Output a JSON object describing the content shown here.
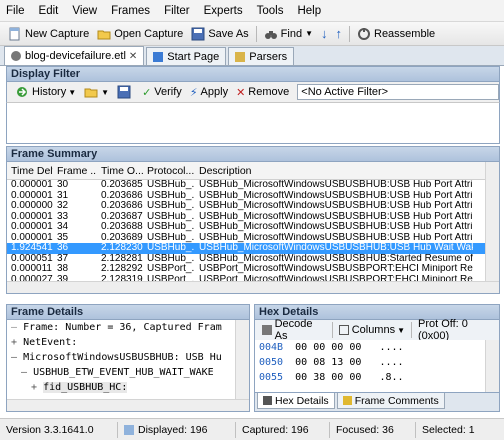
{
  "menu": [
    "File",
    "Edit",
    "View",
    "Frames",
    "Filter",
    "Experts",
    "Tools",
    "Help"
  ],
  "toolbar": {
    "new_capture": "New Capture",
    "open_capture": "Open Capture",
    "save_as": "Save As",
    "find": "Find",
    "reassemble": "Reassemble"
  },
  "tabs": [
    {
      "label": "blog-devicefailure.etl"
    },
    {
      "label": "Start Page"
    },
    {
      "label": "Parsers"
    }
  ],
  "display_filter": {
    "title": "Display Filter",
    "history": "History",
    "verify": "Verify",
    "apply": "Apply",
    "remove": "Remove",
    "active_filter": "<No Active Filter>"
  },
  "frame_summary": {
    "title": "Frame Summary",
    "columns": [
      "Time Delta",
      "Frame ...",
      "Time O...",
      "Protocol...",
      "Description"
    ],
    "rows": [
      {
        "delta": "0.000001",
        "frame": "30",
        "time": "0.203685",
        "protocol": "USBHub_...",
        "desc": "USBHub_MicrosoftWindowsUSBUSBHUB:USB Hub Port Attributes"
      },
      {
        "delta": "0.000001",
        "frame": "31",
        "time": "0.203686",
        "protocol": "USBHub_...",
        "desc": "USBHub_MicrosoftWindowsUSBUSBHUB:USB Hub Port Attributes"
      },
      {
        "delta": "0.000000",
        "frame": "32",
        "time": "0.203686",
        "protocol": "USBHub_...",
        "desc": "USBHub_MicrosoftWindowsUSBUSBHUB:USB Hub Port Attributes"
      },
      {
        "delta": "0.000001",
        "frame": "33",
        "time": "0.203687",
        "protocol": "USBHub_...",
        "desc": "USBHub_MicrosoftWindowsUSBUSBHUB:USB Hub Port Attributes"
      },
      {
        "delta": "0.000001",
        "frame": "34",
        "time": "0.203688",
        "protocol": "USBHub_...",
        "desc": "USBHub_MicrosoftWindowsUSBUSBHUB:USB Hub Port Attributes"
      },
      {
        "delta": "0.000001",
        "frame": "35",
        "time": "0.203689",
        "protocol": "USBHub_...",
        "desc": "USBHub_MicrosoftWindowsUSBUSBHUB:USB Hub Port Attributes"
      },
      {
        "delta": "1.924541",
        "frame": "36",
        "time": "2.128230",
        "protocol": "USBHub_...",
        "desc": "USBHub_MicrosoftWindowsUSBUSBHUB:USB Hub Wait Wake IRP Complet"
      },
      {
        "delta": "0.000051",
        "frame": "37",
        "time": "2.128281",
        "protocol": "USBHub_...",
        "desc": "USBHub_MicrosoftWindowsUSBUSBHUB:Started Resume of Hub from Se"
      },
      {
        "delta": "0.000011",
        "frame": "38",
        "time": "2.128292",
        "protocol": "USBPort_...",
        "desc": "USBPort_MicrosoftWindowsUSBUSBPORT:EHCI Miniport Resume Dispatch"
      },
      {
        "delta": "0.000027",
        "frame": "39",
        "time": "2.128319",
        "protocol": "USBPort_...",
        "desc": "USBPort_MicrosoftWindowsUSBUSBPORT:EHCI Miniport Resume Complet"
      }
    ]
  },
  "frame_details": {
    "title": "Frame Details",
    "lines": [
      "Frame: Number = 36, Captured Fram",
      "NetEvent:",
      "MicrosoftWindowsUSBUSBHUB: USB Hu",
      "USBHUB_ETW_EVENT_HUB_WAIT_WAKE",
      "fid_USBHUB_HC:"
    ]
  },
  "hex_details": {
    "title": "Hex Details",
    "decode_as": "Decode As",
    "columns": "Columns",
    "prot_off": "Prot Off: 0 (0x00)",
    "rows": [
      {
        "addr": "004B",
        "bytes": "00 00 00 00",
        "ascii": "...."
      },
      {
        "addr": "0050",
        "bytes": "00 08 13 00",
        "ascii": "...."
      },
      {
        "addr": "0055",
        "bytes": "00 38 00 00",
        "ascii": ".8.."
      }
    ],
    "tab_hex": "Hex Details",
    "tab_comments": "Frame Comments"
  },
  "status": {
    "version": "Version 3.3.1641.0",
    "displayed": "Displayed: 196",
    "captured": "Captured: 196",
    "focused": "Focused: 36",
    "selected": "Selected: 1"
  },
  "selected_row_index": 6
}
